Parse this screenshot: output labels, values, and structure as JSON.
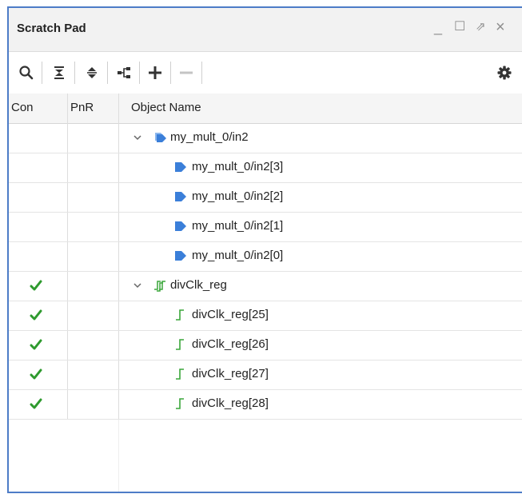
{
  "panel": {
    "title": "Scratch Pad",
    "window_controls": {
      "minimize": "_",
      "maximize": "☐",
      "restore": "⇗",
      "close": "×"
    }
  },
  "toolbar": {
    "icons": [
      "search-icon",
      "collapse-all-icon",
      "expand-all-icon",
      "hierarchy-icon",
      "add-icon",
      "remove-icon",
      "settings-icon"
    ]
  },
  "columns": [
    "Con",
    "PnR",
    "Object Name"
  ],
  "rows": [
    {
      "con": false,
      "name": "my_mult_0/in2",
      "type": "bus-in",
      "expanded": true,
      "level": 0
    },
    {
      "con": false,
      "name": "my_mult_0/in2[3]",
      "type": "port-in",
      "level": 1
    },
    {
      "con": false,
      "name": "my_mult_0/in2[2]",
      "type": "port-in",
      "level": 1
    },
    {
      "con": false,
      "name": "my_mult_0/in2[1]",
      "type": "port-in",
      "level": 1
    },
    {
      "con": false,
      "name": "my_mult_0/in2[0]",
      "type": "port-in",
      "level": 1
    },
    {
      "con": true,
      "name": "divClk_reg",
      "type": "reg-bus",
      "expanded": true,
      "level": 0
    },
    {
      "con": true,
      "name": "divClk_reg[25]",
      "type": "reg",
      "level": 1
    },
    {
      "con": true,
      "name": "divClk_reg[26]",
      "type": "reg",
      "level": 1
    },
    {
      "con": true,
      "name": "divClk_reg[27]",
      "type": "reg",
      "level": 1
    },
    {
      "con": true,
      "name": "divClk_reg[28]",
      "type": "reg",
      "level": 1
    }
  ],
  "colors": {
    "accent_border": "#4d7cc7",
    "check_green": "#2e9a2e",
    "port_blue": "#3b7fd9",
    "reg_green": "#3aa63a"
  }
}
